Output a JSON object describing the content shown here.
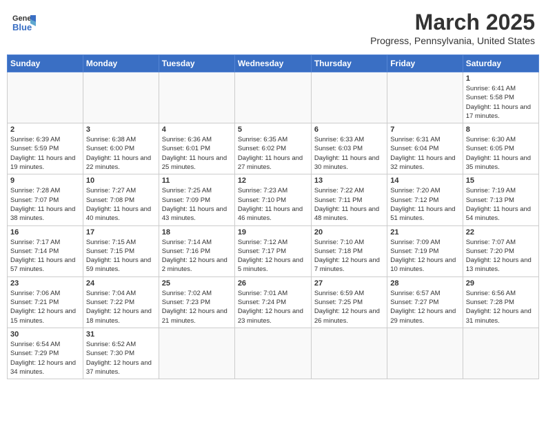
{
  "header": {
    "logo_line1": "General",
    "logo_line2": "Blue",
    "month_title": "March 2025",
    "location": "Progress, Pennsylvania, United States"
  },
  "weekdays": [
    "Sunday",
    "Monday",
    "Tuesday",
    "Wednesday",
    "Thursday",
    "Friday",
    "Saturday"
  ],
  "weeks": [
    [
      {
        "day": "",
        "info": ""
      },
      {
        "day": "",
        "info": ""
      },
      {
        "day": "",
        "info": ""
      },
      {
        "day": "",
        "info": ""
      },
      {
        "day": "",
        "info": ""
      },
      {
        "day": "",
        "info": ""
      },
      {
        "day": "1",
        "info": "Sunrise: 6:41 AM\nSunset: 5:58 PM\nDaylight: 11 hours and 17 minutes."
      }
    ],
    [
      {
        "day": "2",
        "info": "Sunrise: 6:39 AM\nSunset: 5:59 PM\nDaylight: 11 hours and 19 minutes."
      },
      {
        "day": "3",
        "info": "Sunrise: 6:38 AM\nSunset: 6:00 PM\nDaylight: 11 hours and 22 minutes."
      },
      {
        "day": "4",
        "info": "Sunrise: 6:36 AM\nSunset: 6:01 PM\nDaylight: 11 hours and 25 minutes."
      },
      {
        "day": "5",
        "info": "Sunrise: 6:35 AM\nSunset: 6:02 PM\nDaylight: 11 hours and 27 minutes."
      },
      {
        "day": "6",
        "info": "Sunrise: 6:33 AM\nSunset: 6:03 PM\nDaylight: 11 hours and 30 minutes."
      },
      {
        "day": "7",
        "info": "Sunrise: 6:31 AM\nSunset: 6:04 PM\nDaylight: 11 hours and 32 minutes."
      },
      {
        "day": "8",
        "info": "Sunrise: 6:30 AM\nSunset: 6:05 PM\nDaylight: 11 hours and 35 minutes."
      }
    ],
    [
      {
        "day": "9",
        "info": "Sunrise: 7:28 AM\nSunset: 7:07 PM\nDaylight: 11 hours and 38 minutes."
      },
      {
        "day": "10",
        "info": "Sunrise: 7:27 AM\nSunset: 7:08 PM\nDaylight: 11 hours and 40 minutes."
      },
      {
        "day": "11",
        "info": "Sunrise: 7:25 AM\nSunset: 7:09 PM\nDaylight: 11 hours and 43 minutes."
      },
      {
        "day": "12",
        "info": "Sunrise: 7:23 AM\nSunset: 7:10 PM\nDaylight: 11 hours and 46 minutes."
      },
      {
        "day": "13",
        "info": "Sunrise: 7:22 AM\nSunset: 7:11 PM\nDaylight: 11 hours and 48 minutes."
      },
      {
        "day": "14",
        "info": "Sunrise: 7:20 AM\nSunset: 7:12 PM\nDaylight: 11 hours and 51 minutes."
      },
      {
        "day": "15",
        "info": "Sunrise: 7:19 AM\nSunset: 7:13 PM\nDaylight: 11 hours and 54 minutes."
      }
    ],
    [
      {
        "day": "16",
        "info": "Sunrise: 7:17 AM\nSunset: 7:14 PM\nDaylight: 11 hours and 57 minutes."
      },
      {
        "day": "17",
        "info": "Sunrise: 7:15 AM\nSunset: 7:15 PM\nDaylight: 11 hours and 59 minutes."
      },
      {
        "day": "18",
        "info": "Sunrise: 7:14 AM\nSunset: 7:16 PM\nDaylight: 12 hours and 2 minutes."
      },
      {
        "day": "19",
        "info": "Sunrise: 7:12 AM\nSunset: 7:17 PM\nDaylight: 12 hours and 5 minutes."
      },
      {
        "day": "20",
        "info": "Sunrise: 7:10 AM\nSunset: 7:18 PM\nDaylight: 12 hours and 7 minutes."
      },
      {
        "day": "21",
        "info": "Sunrise: 7:09 AM\nSunset: 7:19 PM\nDaylight: 12 hours and 10 minutes."
      },
      {
        "day": "22",
        "info": "Sunrise: 7:07 AM\nSunset: 7:20 PM\nDaylight: 12 hours and 13 minutes."
      }
    ],
    [
      {
        "day": "23",
        "info": "Sunrise: 7:06 AM\nSunset: 7:21 PM\nDaylight: 12 hours and 15 minutes."
      },
      {
        "day": "24",
        "info": "Sunrise: 7:04 AM\nSunset: 7:22 PM\nDaylight: 12 hours and 18 minutes."
      },
      {
        "day": "25",
        "info": "Sunrise: 7:02 AM\nSunset: 7:23 PM\nDaylight: 12 hours and 21 minutes."
      },
      {
        "day": "26",
        "info": "Sunrise: 7:01 AM\nSunset: 7:24 PM\nDaylight: 12 hours and 23 minutes."
      },
      {
        "day": "27",
        "info": "Sunrise: 6:59 AM\nSunset: 7:25 PM\nDaylight: 12 hours and 26 minutes."
      },
      {
        "day": "28",
        "info": "Sunrise: 6:57 AM\nSunset: 7:27 PM\nDaylight: 12 hours and 29 minutes."
      },
      {
        "day": "29",
        "info": "Sunrise: 6:56 AM\nSunset: 7:28 PM\nDaylight: 12 hours and 31 minutes."
      }
    ],
    [
      {
        "day": "30",
        "info": "Sunrise: 6:54 AM\nSunset: 7:29 PM\nDaylight: 12 hours and 34 minutes."
      },
      {
        "day": "31",
        "info": "Sunrise: 6:52 AM\nSunset: 7:30 PM\nDaylight: 12 hours and 37 minutes."
      },
      {
        "day": "",
        "info": ""
      },
      {
        "day": "",
        "info": ""
      },
      {
        "day": "",
        "info": ""
      },
      {
        "day": "",
        "info": ""
      },
      {
        "day": "",
        "info": ""
      }
    ]
  ]
}
